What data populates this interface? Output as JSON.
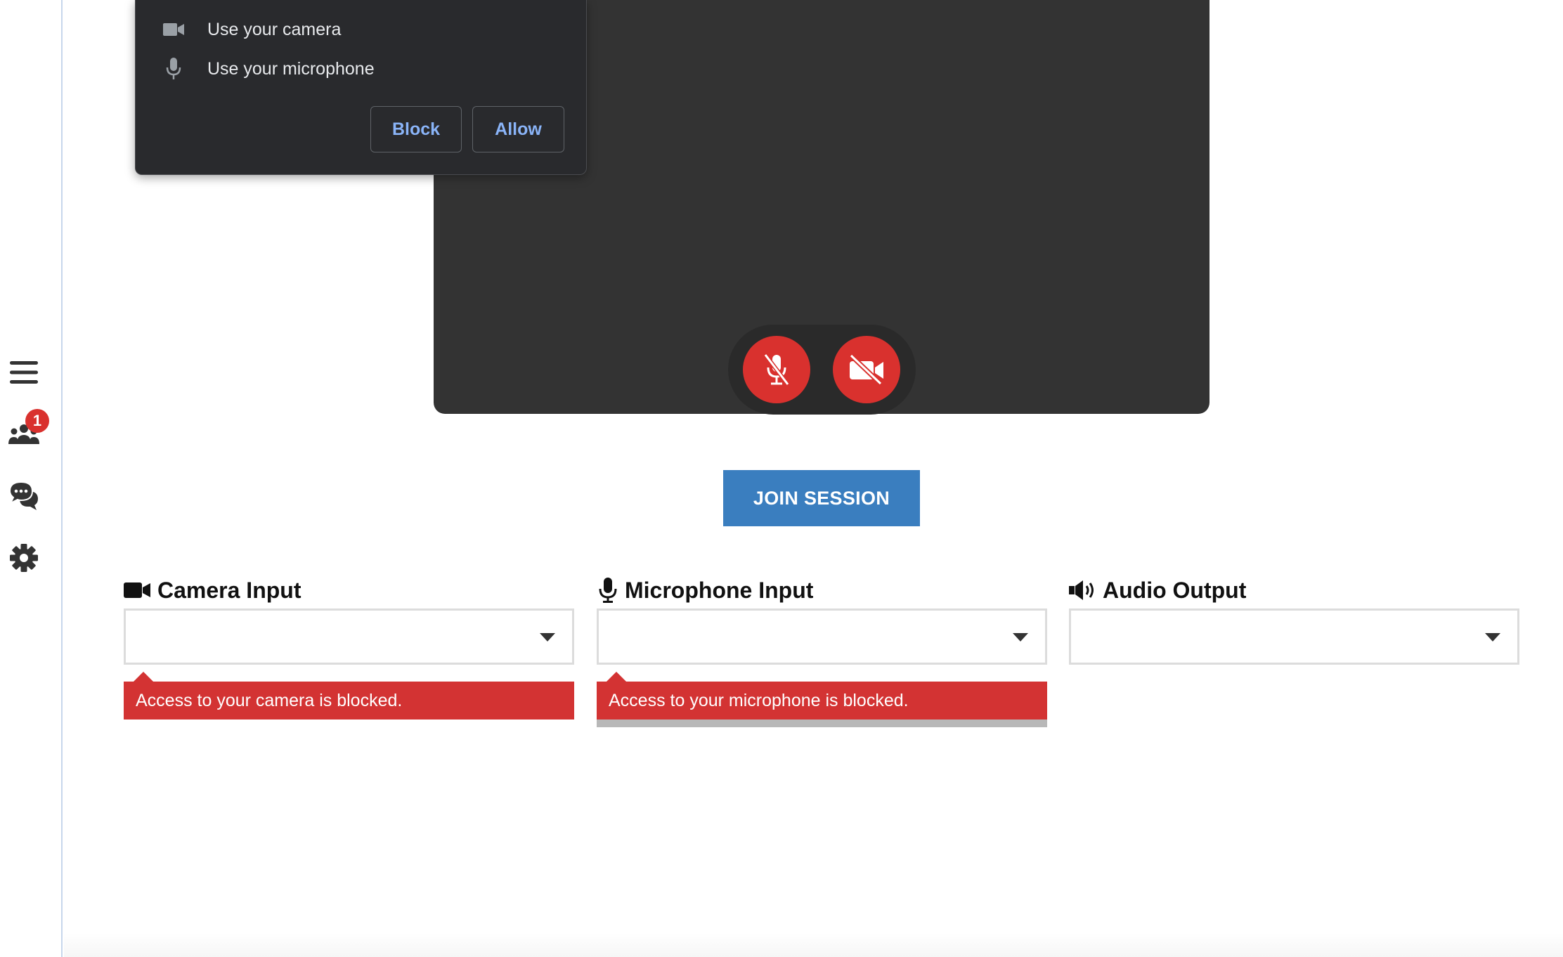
{
  "sidebar": {
    "items": [
      {
        "icon": "hamburger-menu-icon"
      },
      {
        "icon": "participants-icon",
        "badge": "1"
      },
      {
        "icon": "chat-icon"
      },
      {
        "icon": "gear-icon"
      }
    ]
  },
  "permission_popup": {
    "camera_text": "Use your camera",
    "microphone_text": "Use your microphone",
    "block_label": "Block",
    "allow_label": "Allow"
  },
  "video_controls": {
    "mic_state": "muted",
    "camera_state": "off"
  },
  "join_button_label": "JOIN SESSION",
  "devices": {
    "camera": {
      "label": "Camera Input",
      "selected": "",
      "error": "Access to your camera is blocked."
    },
    "microphone": {
      "label": "Microphone Input",
      "selected": "",
      "error": "Access to your microphone is blocked."
    },
    "audio_output": {
      "label": "Audio Output",
      "selected": ""
    }
  },
  "colors": {
    "accent_blue": "#3a7ebf",
    "error_red": "#d33333",
    "control_red": "#d9312e",
    "video_bg": "#333333",
    "popup_bg": "#292a2d",
    "popup_link": "#8ab4f8"
  }
}
